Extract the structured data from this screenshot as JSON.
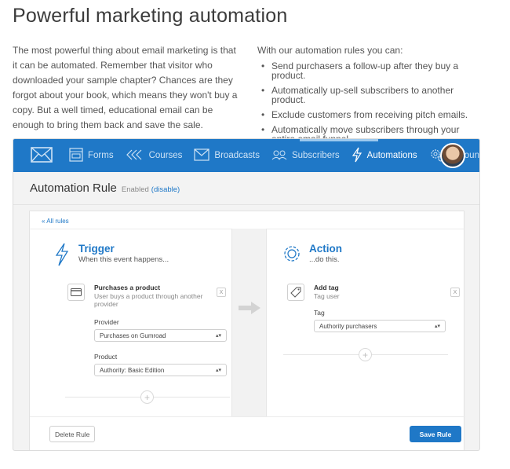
{
  "page": {
    "title": "Powerful marketing automation",
    "intro": "The most powerful thing about email marketing is that it can be automated. Remember that visitor who downloaded your sample chapter? Chances are they forgot about your book, which means they won't buy a copy. But a well timed, educational email can be enough to bring them back and save the sale.",
    "rules_lead": "With our automation rules you can:",
    "bullets": [
      "Send purchasers a follow-up after they buy a product.",
      "Automatically up-sell subscribers to another product.",
      "Exclude customers from receiving pitch emails.",
      "Automatically move subscribers through your entire email funnel."
    ]
  },
  "nav": {
    "items": [
      {
        "label": "",
        "icon": "mail-icon"
      },
      {
        "label": "Forms",
        "icon": "forms-icon"
      },
      {
        "label": "Courses",
        "icon": "courses-icon"
      },
      {
        "label": "Broadcasts",
        "icon": "broadcast-icon"
      },
      {
        "label": "Subscribers",
        "icon": "subscribers-icon"
      },
      {
        "label": "Automations",
        "icon": "automation-icon",
        "active": true
      },
      {
        "label": "Account",
        "icon": "gear-icon"
      }
    ],
    "avatar": "user-avatar"
  },
  "rule": {
    "title": "Automation Rule",
    "status": "Enabled",
    "disable_link": "(disable)",
    "all_rules": "« All rules"
  },
  "trigger": {
    "title": "Trigger",
    "subtitle": "When this event happens...",
    "item_title": "Purchases a product",
    "item_desc": "User buys a product through another provider",
    "remove": "X",
    "provider_label": "Provider",
    "provider_value": "Purchases on Gumroad",
    "product_label": "Product",
    "product_value": "Authority: Basic Edition",
    "add": "+"
  },
  "action": {
    "title": "Action",
    "subtitle": "...do this.",
    "item_title": "Add tag",
    "item_desc": "Tag user",
    "remove": "X",
    "tag_label": "Tag",
    "tag_value": "Authority purchasers",
    "add": "+"
  },
  "footer": {
    "delete_label": "Delete Rule",
    "save_label": "Save Rule"
  },
  "colors": {
    "brand": "#1f78c7",
    "nav_text": "#cfe3f5"
  }
}
